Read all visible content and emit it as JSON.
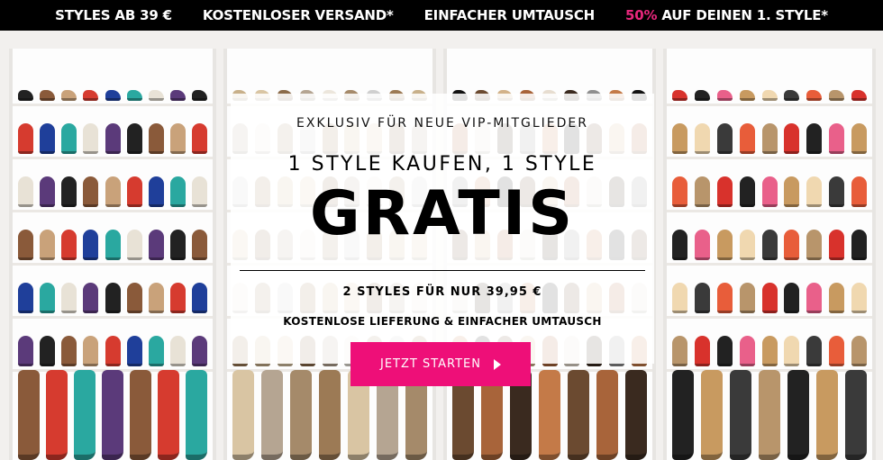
{
  "topbar": {
    "item1": "STYLES AB 39 €",
    "item2": "KOSTENLOSER VERSAND*",
    "item3": "EINFACHER UMTAUSCH",
    "item4_accent": "50%",
    "item4_rest": " AUF DEINEN 1. STYLE*"
  },
  "promo": {
    "eyebrow": "EXKLUSIV FÜR NEUE VIP-MITGLIEDER",
    "headline_small": "1 STYLE KAUFEN, 1 STYLE",
    "headline_large": "GRATIS",
    "offer": "2 STYLES FÜR NUR 39,95 €",
    "shipping": "KOSTENLOSE LIEFERUNG & EINFACHER UMTAUSCH",
    "cta_label": "JETZT STARTEN",
    "cta_icon": "play-arrow-icon"
  },
  "colors": {
    "accent": "#ee0f78",
    "topbar_accent": "#e8277c",
    "topbar_bg": "#000000"
  }
}
